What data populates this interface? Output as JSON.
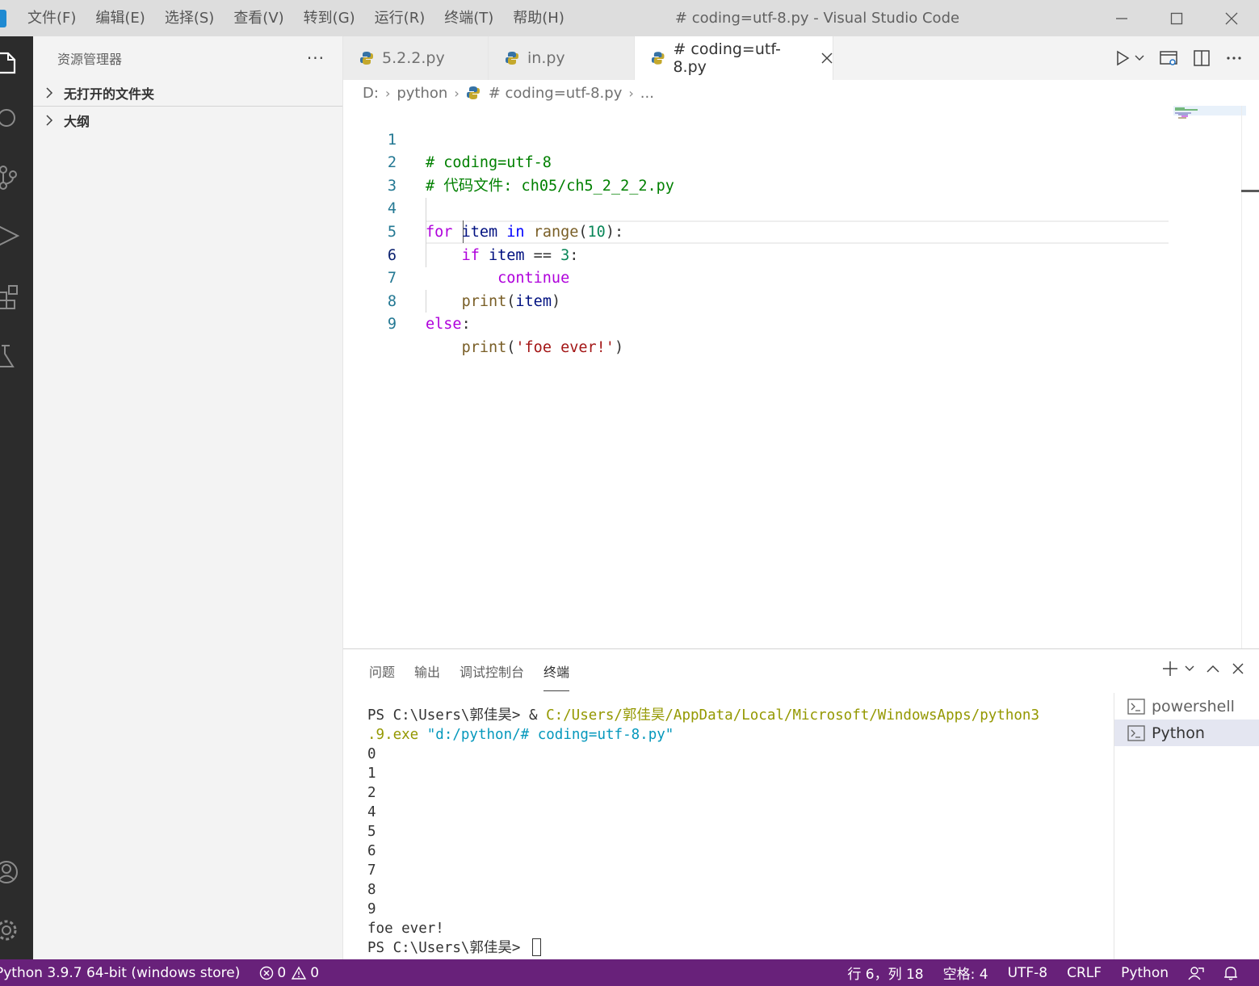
{
  "titlebar": {
    "menu": [
      "文件(F)",
      "编辑(E)",
      "选择(S)",
      "查看(V)",
      "转到(G)",
      "运行(R)",
      "终端(T)",
      "帮助(H)"
    ],
    "window_title": "# coding=utf-8.py - Visual Studio Code"
  },
  "sidebar": {
    "title": "资源管理器",
    "more": "···",
    "sections": [
      "无打开的文件夹",
      "大纲"
    ]
  },
  "tabs": [
    {
      "label": "5.2.2.py"
    },
    {
      "label": "in.py"
    },
    {
      "label": "# coding=utf-8.py"
    }
  ],
  "breadcrumb": [
    "D:",
    "python",
    "# coding=utf-8.py",
    "..."
  ],
  "editor": {
    "line_numbers": [
      "1",
      "2",
      "3",
      "4",
      "5",
      "6",
      "7",
      "8",
      "9"
    ],
    "lines": [
      "# coding=utf-8",
      "# 代码文件: ch05/ch5_2_2_2.py",
      "",
      "for item in range(10):",
      "    if item == 3:",
      "        continue",
      "    print(item)",
      "else:",
      "    print('foe ever!')"
    ]
  },
  "panel": {
    "tabs": [
      "问题",
      "输出",
      "调试控制台",
      "终端"
    ],
    "active_tab": "终端",
    "terminal_lines": {
      "prompt1": "PS C:\\Users\\郭佳昊> & ",
      "cmd_path_a": "C:/Users/郭佳昊/AppData/Local/Microsoft/WindowsApps/python3",
      "cmd_path_b": ".9.exe",
      "cmd_arg": " \"d:/python/# coding=utf-8.py\"",
      "outputs": [
        "0",
        "1",
        "2",
        "4",
        "5",
        "6",
        "7",
        "8",
        "9",
        "foe ever!"
      ],
      "prompt2": "PS C:\\Users\\郭佳昊> "
    },
    "terminals": [
      "powershell",
      "Python"
    ],
    "active_terminal": "Python"
  },
  "statusbar": {
    "interpreter": "Python 3.9.7 64-bit (windows store)",
    "errors": "0",
    "warnings": "0",
    "position": "行 6，列 18",
    "spaces": "空格: 4",
    "encoding": "UTF-8",
    "eol": "CRLF",
    "language": "Python",
    "background": "#68217a"
  }
}
